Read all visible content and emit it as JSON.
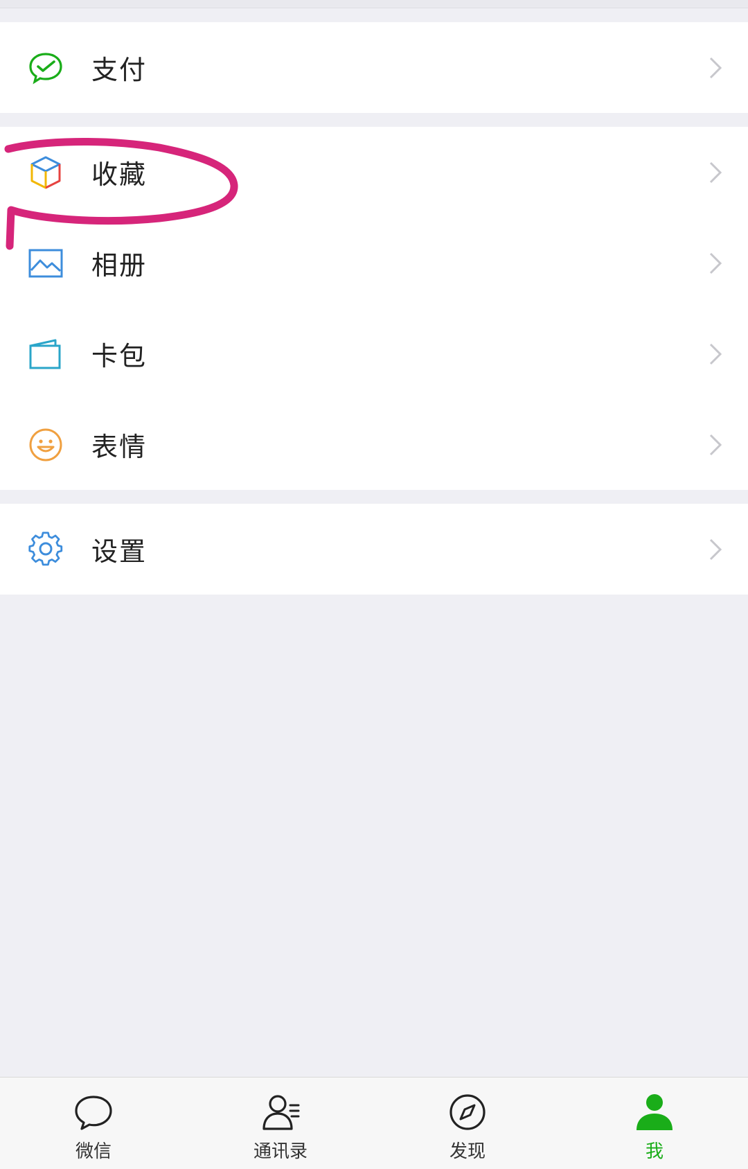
{
  "colors": {
    "accent": "#1aad19",
    "annotation": "#d6257a",
    "background": "#efeff4"
  },
  "menu": {
    "pay": {
      "label": "支付",
      "icon": "wechat-pay-icon"
    },
    "favorites": {
      "label": "收藏",
      "icon": "cube-icon"
    },
    "album": {
      "label": "相册",
      "icon": "photo-icon"
    },
    "cards": {
      "label": "卡包",
      "icon": "wallet-icon"
    },
    "stickers": {
      "label": "表情",
      "icon": "smile-icon"
    },
    "settings": {
      "label": "设置",
      "icon": "gear-icon"
    }
  },
  "tabbar": {
    "chats": {
      "label": "微信",
      "icon": "chat-bubble-icon"
    },
    "contacts": {
      "label": "通讯录",
      "icon": "contacts-icon"
    },
    "discover": {
      "label": "发现",
      "icon": "compass-icon"
    },
    "me": {
      "label": "我",
      "icon": "person-icon",
      "active": true
    }
  }
}
